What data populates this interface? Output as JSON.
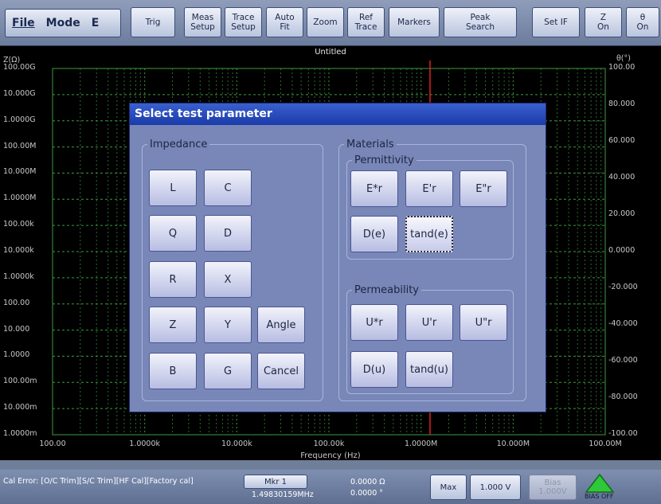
{
  "toolbar": {
    "menu": {
      "file": "File",
      "mode": "Mode",
      "mode_value": "E"
    },
    "buttons": [
      {
        "label": "Trig"
      },
      {
        "label": "Meas\nSetup"
      },
      {
        "label": "Trace\nSetup"
      },
      {
        "label": "Auto\nFit"
      },
      {
        "label": "Zoom"
      },
      {
        "label": "Ref\nTrace"
      },
      {
        "label": "Markers"
      },
      {
        "label": "Peak\nSearch"
      },
      {
        "label": "Set IF"
      },
      {
        "label": "Z\nOn"
      },
      {
        "label": "θ\nOn"
      }
    ]
  },
  "plot": {
    "title": "Untitled",
    "y_left_title": "Z(Ω)",
    "y_right_title": "θ(°)",
    "y_left_ticks": [
      "100.00G",
      "10.000G",
      "1.0000G",
      "100.00M",
      "10.000M",
      "1.0000M",
      "100.00k",
      "10.000k",
      "1.0000k",
      "100.00",
      "10.000",
      "1.0000",
      "100.00m",
      "10.000m",
      "1.0000m"
    ],
    "y_right_ticks": [
      "100.00",
      "80.000",
      "60.000",
      "40.000",
      "20.000",
      "0.0000",
      "-20.000",
      "-40.000",
      "-60.000",
      "-80.000",
      "-100.00"
    ],
    "x_ticks": [
      "100.00",
      "1.0000k",
      "10.000k",
      "100.00k",
      "1.0000M",
      "10.000M",
      "100.00M"
    ],
    "x_title": "Frequency (Hz)",
    "colors": {
      "grid": "#3f9a3f",
      "marker": "#e02020",
      "background": "#000000"
    }
  },
  "dialog": {
    "title": "Select test parameter",
    "impedance": {
      "legend": "Impedance",
      "buttons": [
        "L",
        "C",
        "Q",
        "D",
        "R",
        "X",
        "Z",
        "Y",
        "Angle",
        "B",
        "G",
        "Cancel"
      ]
    },
    "materials": {
      "legend": "Materials",
      "permittivity": {
        "legend": "Permittivity",
        "buttons": [
          "E*r",
          "E'r",
          "E\"r",
          "D(e)",
          "tand(e)"
        ],
        "selected": "tand(e)"
      },
      "permeability": {
        "legend": "Permeability",
        "buttons": [
          "U*r",
          "U'r",
          "U\"r",
          "D(u)",
          "tand(u)"
        ]
      }
    }
  },
  "status": {
    "cal_error": "Cal Error: [O/C Trim][S/C Trim][HF Cal][Factory cal]",
    "marker_button": "Mkr 1",
    "marker_freq": "1.49830159MHz",
    "marker_z": "0.0000 Ω",
    "marker_theta": "0.0000 °",
    "max_button": "Max",
    "voltage_button": "1.000 V",
    "bias_label": "Bias",
    "bias_value": "1.000V",
    "bias_off": "BIAS OFF"
  }
}
